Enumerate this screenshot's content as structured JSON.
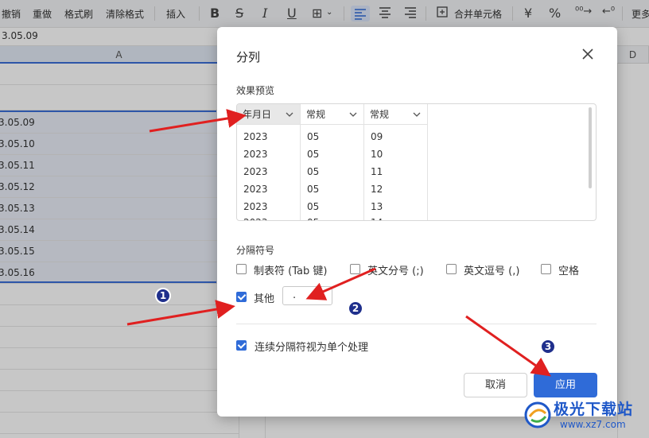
{
  "toolbar": {
    "undo": "撤销",
    "redo": "重做",
    "format_painter": "格式刷",
    "clear_format": "清除格式",
    "insert": "插入",
    "bold": "B",
    "strike": "S",
    "italic": "I",
    "underline": "U",
    "border": "⊞",
    "merge": "合并单元格",
    "currency": "¥",
    "percent": "%",
    "more": "更多"
  },
  "formula_bar": {
    "value": "3.05.09"
  },
  "columns": {
    "a": "A",
    "d": "D"
  },
  "cells": [
    "3.05.09",
    "3.05.10",
    "3.05.11",
    "3.05.12",
    "3.05.13",
    "3.05.14",
    "3.05.15",
    "3.05.16"
  ],
  "dialog": {
    "title": "分列",
    "preview_label": "效果预览",
    "preview": {
      "columns": [
        {
          "header": "年月日",
          "values": [
            "2023",
            "2023",
            "2023",
            "2023",
            "2023",
            "2023"
          ]
        },
        {
          "header": "常规",
          "values": [
            "05",
            "05",
            "05",
            "05",
            "05",
            "05"
          ]
        },
        {
          "header": "常规",
          "values": [
            "09",
            "10",
            "11",
            "12",
            "13",
            "14"
          ]
        }
      ]
    },
    "separator_label": "分隔符号",
    "options": {
      "tab": "制表符 (Tab 键)",
      "semicolon": "英文分号 (;)",
      "comma": "英文逗号 (,)",
      "space": "空格",
      "other": "其他",
      "other_value": "."
    },
    "consecutive": "连续分隔符视为单个处理",
    "cancel": "取消",
    "apply": "应用"
  },
  "annotations": {
    "badge1": "1",
    "badge2": "2",
    "badge3": "3"
  },
  "watermark": {
    "title": "极光下载站",
    "url": "www.xz7.com"
  },
  "colors": {
    "accent": "#2f6bd8",
    "arrow": "#e02020",
    "badge": "#1f2f8c"
  }
}
